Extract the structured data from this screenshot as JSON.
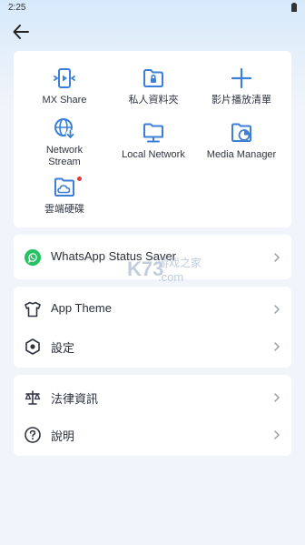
{
  "status_bar": {
    "time": "2:25"
  },
  "colors": {
    "accent": "#3b7fd6",
    "whatsapp": "#25c163",
    "badge": "#e5393a",
    "background": "#f1f4fa"
  },
  "grid": [
    {
      "name": "mx-share",
      "label": "MX Share",
      "icon": "mx-share-icon"
    },
    {
      "name": "private-folder",
      "label": "私人資料夾",
      "icon": "locked-folder-icon"
    },
    {
      "name": "playlist",
      "label": "影片播放清單",
      "icon": "plus-icon"
    },
    {
      "name": "network-stream",
      "label": "Network\nStream",
      "icon": "globe-download-icon"
    },
    {
      "name": "local-network",
      "label": "Local Network",
      "icon": "folder-monitor-icon"
    },
    {
      "name": "media-manager",
      "label": "Media Manager",
      "icon": "folder-chart-icon"
    },
    {
      "name": "cloud-drive",
      "label": "雲端硬碟",
      "icon": "cloud-folder-icon"
    }
  ],
  "whatsapp": {
    "label": "WhatsApp Status Saver",
    "icon": "whatsapp-icon"
  },
  "settings": [
    {
      "label": "App Theme",
      "icon": "tshirt-icon"
    },
    {
      "label": "設定",
      "icon": "hexagon-settings-icon"
    }
  ],
  "info": [
    {
      "label": "法律資訊",
      "icon": "scale-icon"
    },
    {
      "label": "說明",
      "icon": "help-icon"
    }
  ],
  "watermark": {
    "text": "游戏之家",
    "logo": "K73",
    "domain": ".com"
  }
}
